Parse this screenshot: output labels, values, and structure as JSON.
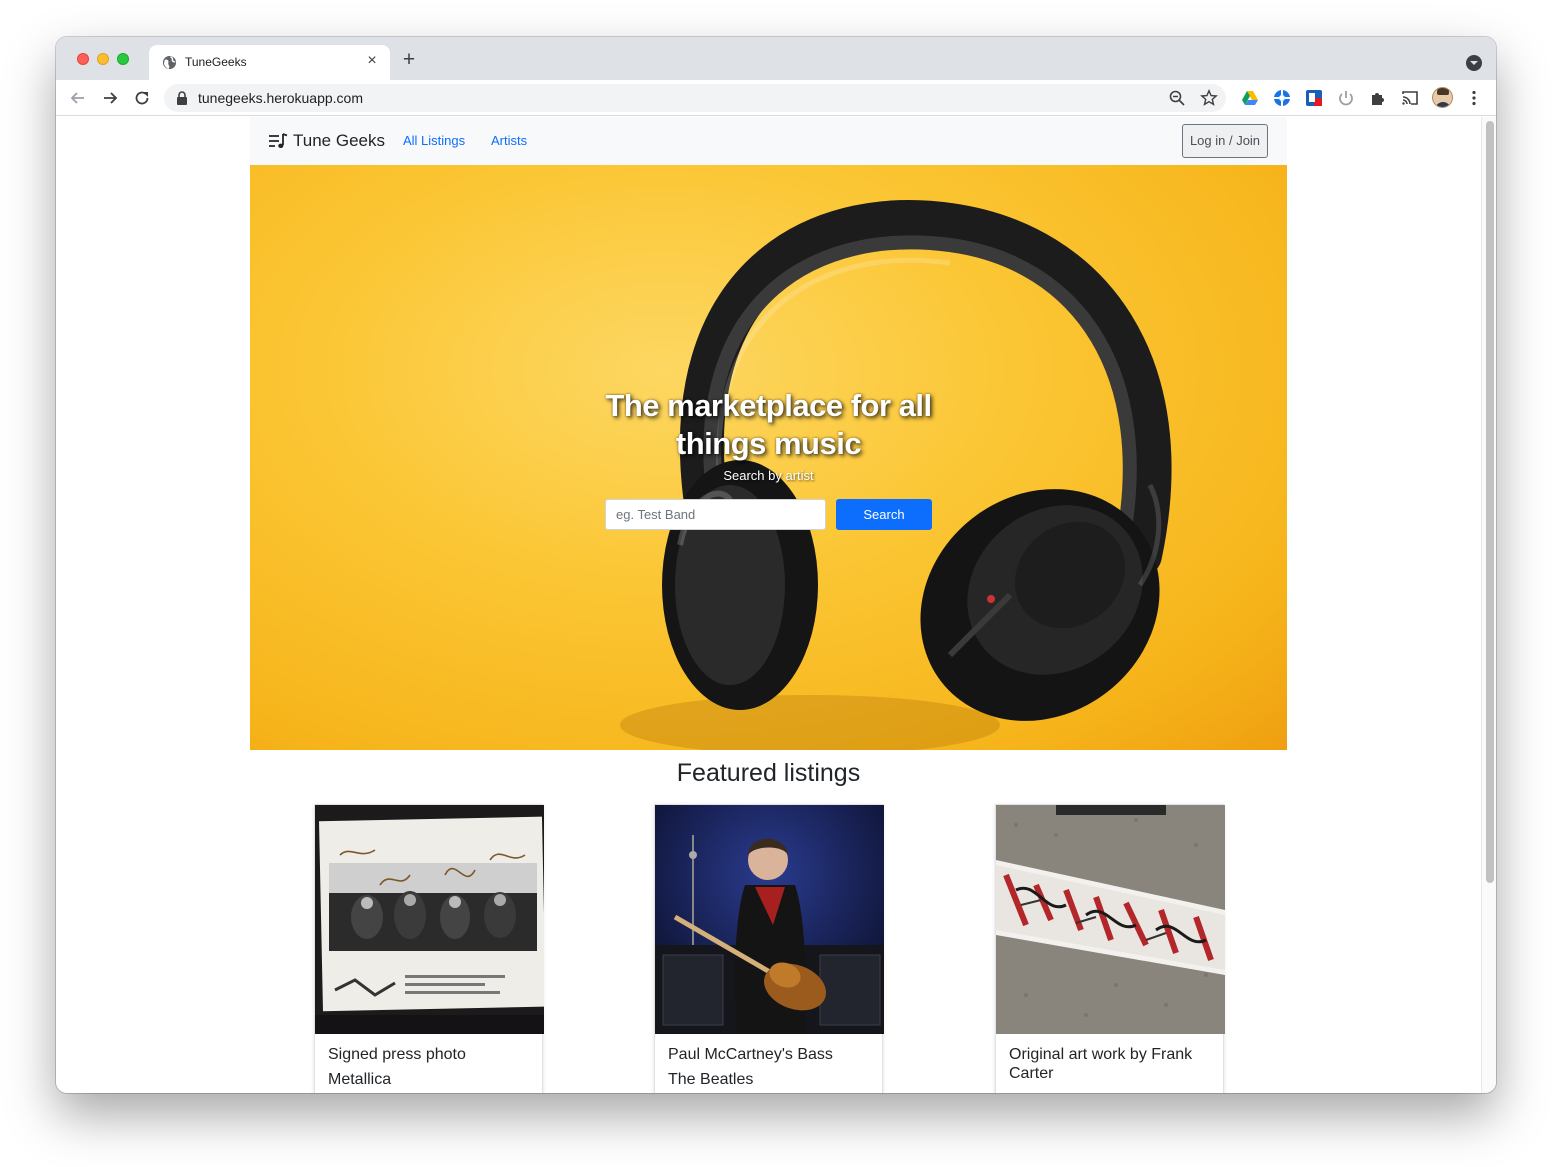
{
  "browser": {
    "tab_title": "TuneGeeks",
    "url": "tunegeeks.herokuapp.com",
    "extensions": [
      "google-drive-icon",
      "blue-circle-extension-icon",
      "red-square-extension-icon",
      "power-icon",
      "puzzle-icon",
      "cast-icon"
    ]
  },
  "navbar": {
    "brand": "Tune Geeks",
    "links": [
      {
        "label": "All Listings"
      },
      {
        "label": "Artists"
      }
    ],
    "login_label": "Log in / Join"
  },
  "hero": {
    "title": "The marketplace for all things music",
    "subtitle": "Search by artist",
    "search_placeholder": "eg. Test Band",
    "search_button": "Search"
  },
  "featured": {
    "heading": "Featured listings",
    "cards": [
      {
        "title": "Signed press photo",
        "artist": "Metallica"
      },
      {
        "title": "Paul McCartney's Bass",
        "artist": "The Beatles"
      },
      {
        "title": "Original art work by Frank Carter",
        "artist": ""
      }
    ]
  },
  "colors": {
    "link_blue": "#0d6efd",
    "hero_yellow": "#fbc634",
    "navbar_bg": "#f8f9fa"
  }
}
